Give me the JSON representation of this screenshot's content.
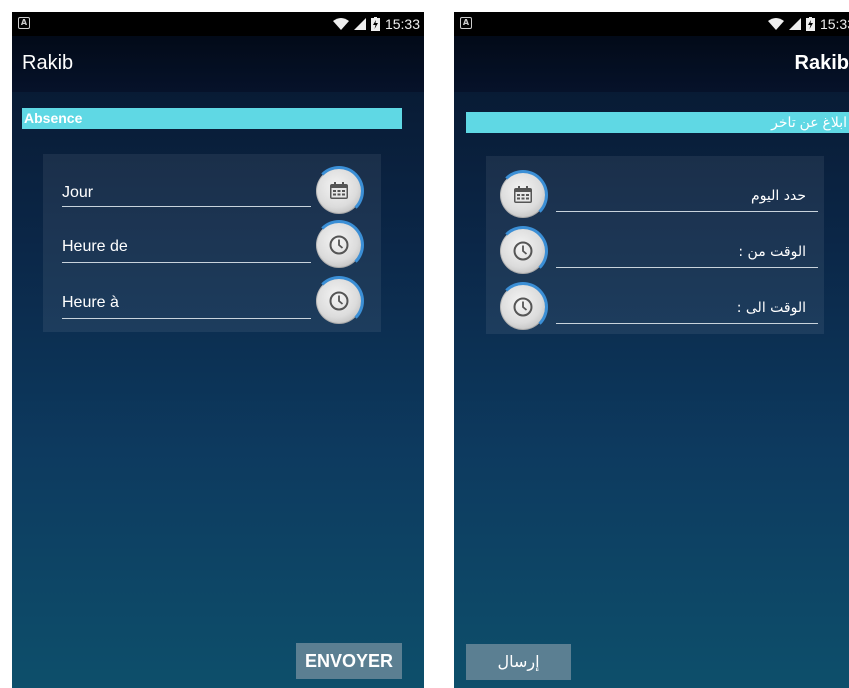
{
  "status_bar": {
    "time": "15:33",
    "notification_icon": "a-notification-icon",
    "wifi_icon": "wifi-icon",
    "signal_icon": "signal-icon",
    "battery_icon": "battery-charging-icon"
  },
  "left_screen": {
    "app_title": "Rakib",
    "section_title": "Absence",
    "fields": [
      {
        "label": "Jour",
        "icon": "calendar-icon"
      },
      {
        "label": "Heure de",
        "icon": "clock-icon"
      },
      {
        "label": "Heure à",
        "icon": "clock-icon"
      }
    ],
    "send_label": "ENVOYER"
  },
  "right_screen": {
    "app_title": "Rakib",
    "section_title": "ابلاغ عن تاخر",
    "fields": [
      {
        "label": "حدد اليوم",
        "icon": "calendar-icon"
      },
      {
        "label": "الوقت من :",
        "icon": "clock-icon"
      },
      {
        "label": "الوقت الى :",
        "icon": "clock-icon"
      }
    ],
    "send_label": "إرسال"
  },
  "colors": {
    "banner": "#5fd8e4",
    "send_button": "#5b7f92",
    "icon_ring": "#3b8fd6"
  }
}
